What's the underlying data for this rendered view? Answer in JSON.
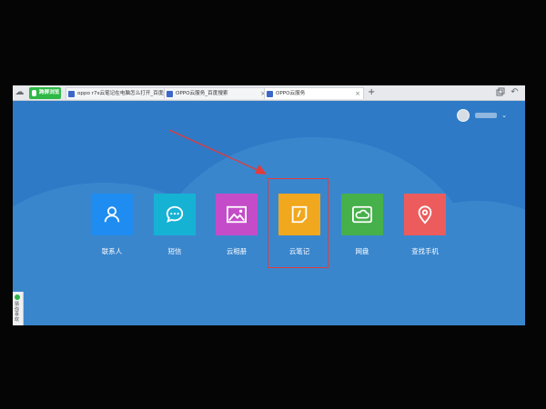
{
  "browser": {
    "tabs": [
      {
        "label": "跨屏浏览",
        "style": "green"
      },
      {
        "label": "oppo r7s云笔记在电脑怎么打开_百度"
      },
      {
        "label": "OPPO云服务_百度搜索"
      },
      {
        "label": "OPPO云服务"
      }
    ],
    "new_tab_symbol": "+"
  },
  "sidebar": {
    "label": "猜你喜欢"
  },
  "user": {
    "menu_caret": "⌄"
  },
  "apps": [
    {
      "label": "联系人",
      "color": "#1e8cf0",
      "icon": "person-icon"
    },
    {
      "label": "短信",
      "color": "#16b2d4",
      "icon": "message-icon"
    },
    {
      "label": "云相册",
      "color": "#c54cc9",
      "icon": "photo-icon"
    },
    {
      "label": "云笔记",
      "color": "#f1a81e",
      "icon": "note-icon"
    },
    {
      "label": "网盘",
      "color": "#46b04a",
      "icon": "cloud-drive-icon"
    },
    {
      "label": "查找手机",
      "color": "#ec5c5c",
      "icon": "location-icon"
    }
  ],
  "annotation": {
    "highlighted_app": "云笔记",
    "arrow_color": "#e23b3b"
  }
}
